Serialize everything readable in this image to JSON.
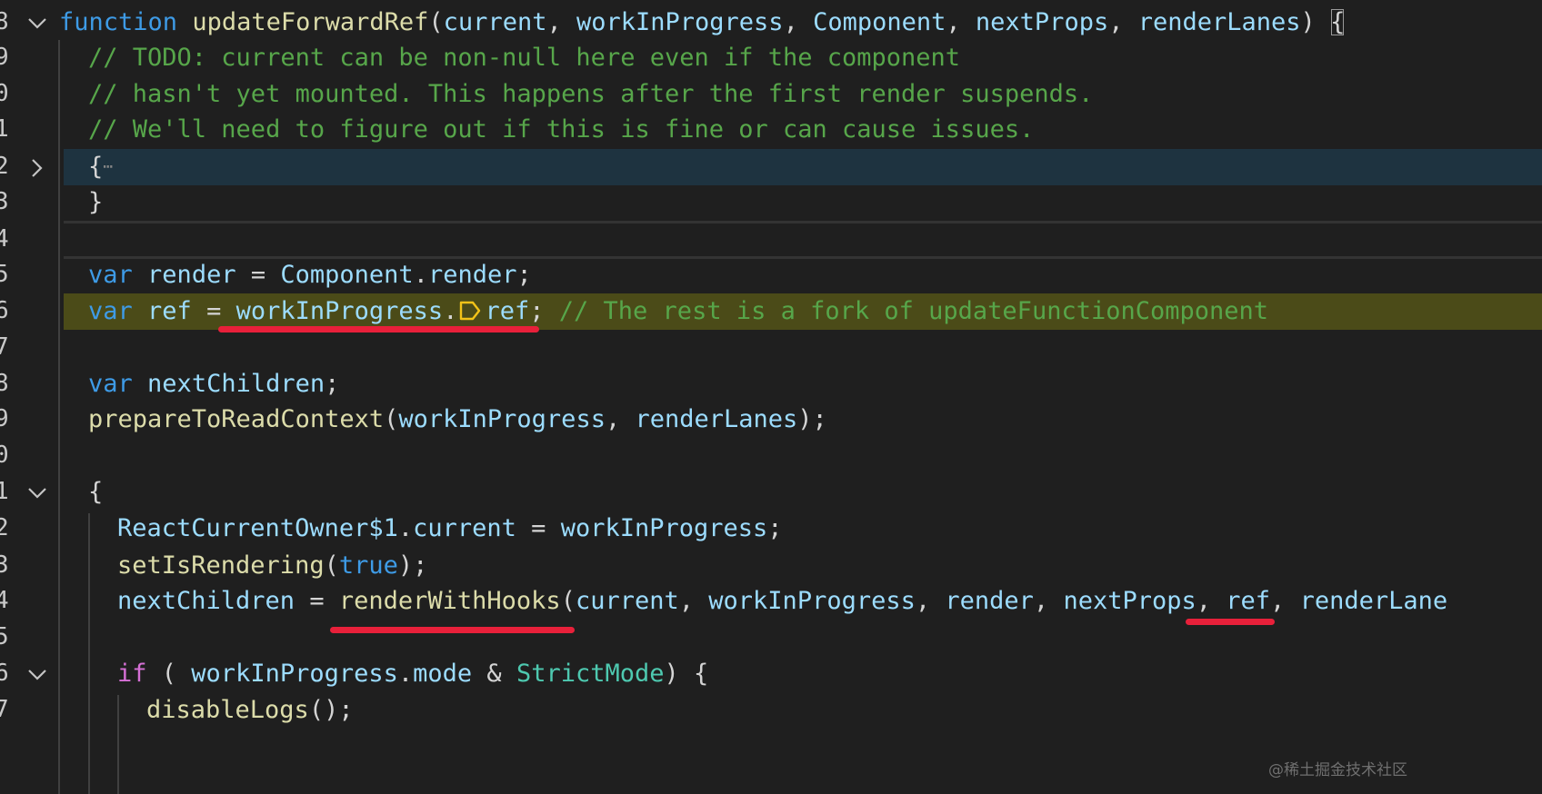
{
  "editor": {
    "accent_colors": {
      "keyword": "#3e9be6",
      "function": "#dcdcaa",
      "variable": "#9cdcfe",
      "class": "#4ec9b0",
      "comment": "#57a64a",
      "control": "#d670d6",
      "annotation_underline": "#e8203a",
      "debug_line_highlight": "#4b4b18",
      "folded_line_highlight": "#1e3340"
    },
    "line_numbers": [
      "8",
      "9",
      "0",
      "1",
      "2",
      "3",
      "4",
      "5",
      "6",
      "7",
      "8",
      "9",
      "0",
      "1",
      "2",
      "3",
      "4",
      "5",
      "6",
      "7"
    ],
    "fold_icons": {
      "line1": "chevron-down-icon",
      "line5": "chevron-right-icon",
      "line14": "chevron-down-icon",
      "line18": "chevron-down-icon"
    },
    "lines": {
      "l1": {
        "kw_function": "function",
        "name": "updateForwardRef",
        "open_paren": "(",
        "p1": "current",
        "c1": ", ",
        "p2": "workInProgress",
        "c2": ", ",
        "p3": "Component",
        "c3": ", ",
        "p4": "nextProps",
        "c4": ", ",
        "p5": "renderLanes",
        "close_paren": ") ",
        "brace": "{"
      },
      "l2": "// TODO: current can be non-null here even if the component",
      "l3": "// hasn't yet mounted. This happens after the first render suspends.",
      "l4": "// We'll need to figure out if this is fine or can cause issues.",
      "l5": {
        "brace": "{",
        "ellipsis": "⋯"
      },
      "l6": "}",
      "l8": {
        "kw": "var",
        "name": "render",
        "eq": " = ",
        "obj": "Component",
        "dot": ".",
        "prop": "render",
        "end": ";"
      },
      "l9": {
        "kw": "var",
        "name": "ref",
        "eq": " = ",
        "obj": "workInProgress",
        "dot": ".",
        "prop": "ref",
        "end": ";",
        "comment": "// The rest is a fork of updateFunctionComponent"
      },
      "l11": {
        "kw": "var",
        "name": "nextChildren",
        "end": ";"
      },
      "l12": {
        "fn": "prepareToReadContext",
        "open": "(",
        "a1": "workInProgress",
        "c1": ", ",
        "a2": "renderLanes",
        "close": ");"
      },
      "l14": "{",
      "l15": {
        "obj": "ReactCurrentOwner$1",
        "dot": ".",
        "prop": "current",
        "eq": " = ",
        "val": "workInProgress",
        "end": ";"
      },
      "l16": {
        "fn": "setIsRendering",
        "open": "(",
        "arg": "true",
        "close": ");"
      },
      "l17": {
        "lhs": "nextChildren",
        "eq": " = ",
        "fn": "renderWithHooks",
        "open": "(",
        "a1": "current",
        "c1": ", ",
        "a2": "workInProgress",
        "c2": ", ",
        "a3": "render",
        "c3": ", ",
        "a4": "nextProps",
        "c4": ", ",
        "a5": "ref",
        "c5": ", ",
        "a6": "renderLane"
      },
      "l19": {
        "kw": "if",
        "open": " ( ",
        "obj": "workInProgress",
        "dot": ".",
        "prop": "mode",
        "op": " & ",
        "cls": "StrictMode",
        "close": ") {"
      },
      "l20": {
        "fn": "disableLogs",
        "end": "();"
      }
    },
    "watermark": "@稀土掘金技术社区"
  }
}
